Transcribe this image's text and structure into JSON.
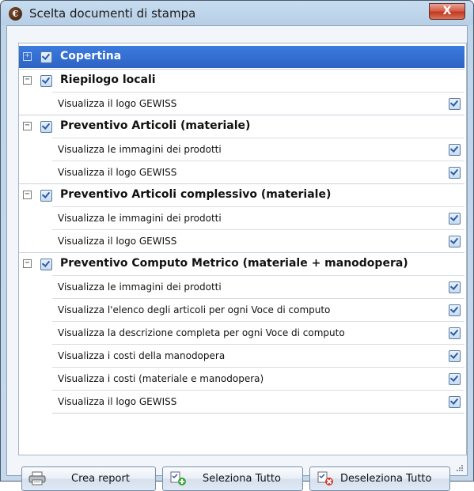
{
  "window": {
    "title": "Scelta documenti di stampa",
    "app_icon_glyph": "€",
    "close_glyph": "X"
  },
  "tree": [
    {
      "label": "Copertina",
      "checked": true,
      "expander": "+",
      "selected": true,
      "children": []
    },
    {
      "label": "Riepilogo locali",
      "checked": true,
      "expander": "−",
      "children": [
        {
          "label": "Visualizza il logo GEWISS",
          "checked": true
        }
      ]
    },
    {
      "label": "Preventivo Articoli (materiale)",
      "checked": true,
      "expander": "−",
      "children": [
        {
          "label": "Visualizza le immagini dei prodotti",
          "checked": true
        },
        {
          "label": "Visualizza il logo GEWISS",
          "checked": true
        }
      ]
    },
    {
      "label": "Preventivo Articoli complessivo (materiale)",
      "checked": true,
      "expander": "−",
      "children": [
        {
          "label": "Visualizza le immagini dei prodotti",
          "checked": true
        },
        {
          "label": "Visualizza il logo GEWISS",
          "checked": true
        }
      ]
    },
    {
      "label": "Preventivo Computo Metrico (materiale + manodopera)",
      "checked": true,
      "expander": "−",
      "children": [
        {
          "label": "Visualizza le immagini dei prodotti",
          "checked": true
        },
        {
          "label": "Visualizza l'elenco degli articoli per ogni Voce di computo",
          "checked": true
        },
        {
          "label": "Visualizza la descrizione completa per ogni Voce di computo",
          "checked": true
        },
        {
          "label": "Visualizza i costi della manodopera",
          "checked": true
        },
        {
          "label": "Visualizza i costi (materiale e manodopera)",
          "checked": true
        },
        {
          "label": "Visualizza il logo GEWISS",
          "checked": true
        }
      ]
    }
  ],
  "buttons": {
    "create_report": "Crea report",
    "select_all": "Seleziona Tutto",
    "deselect_all": "Deseleziona Tutto"
  },
  "icons": {
    "app": "euro-app-icon",
    "close": "close-icon",
    "create_report": "printer-icon",
    "select_all": "select-all-icon",
    "deselect_all": "deselect-all-icon"
  }
}
